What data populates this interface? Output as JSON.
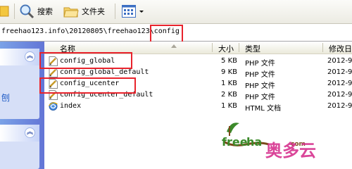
{
  "toolbar": {
    "search_label": "搜索",
    "folders_label": "文件夹"
  },
  "address": {
    "path_prefix": "freehao123.info\\20120805\\freehao123\\",
    "path_current": "config"
  },
  "columns": {
    "name": "名称",
    "size": "大小",
    "type": "类型",
    "modified": "修改日"
  },
  "files": [
    {
      "name": "config_global",
      "size": "5 KB",
      "type": "PHP 文件",
      "modified": "2012-9"
    },
    {
      "name": "config_global_default",
      "size": "9 KB",
      "type": "PHP 文件",
      "modified": "2012-9"
    },
    {
      "name": "config_ucenter",
      "size": "1 KB",
      "type": "PHP 文件",
      "modified": "2012-9"
    },
    {
      "name": "config_ucenter_default",
      "size": "2 KB",
      "type": "PHP 文件",
      "modified": "2012-9"
    },
    {
      "name": "index",
      "size": "1 KB",
      "type": "HTML 文档",
      "modified": "2012-9"
    }
  ],
  "left_fragment": "刨",
  "watermark": {
    "brand": "free",
    "brand_tail": "ha",
    "domain_tail": "com",
    "cn": "奥多云"
  },
  "colors": {
    "highlight": "#e8232c",
    "taskpane": "#6b86dc",
    "watermark_green": "#3b8a2a",
    "watermark_brown": "#7a4a1a",
    "watermark_cn": "#d6338f"
  }
}
